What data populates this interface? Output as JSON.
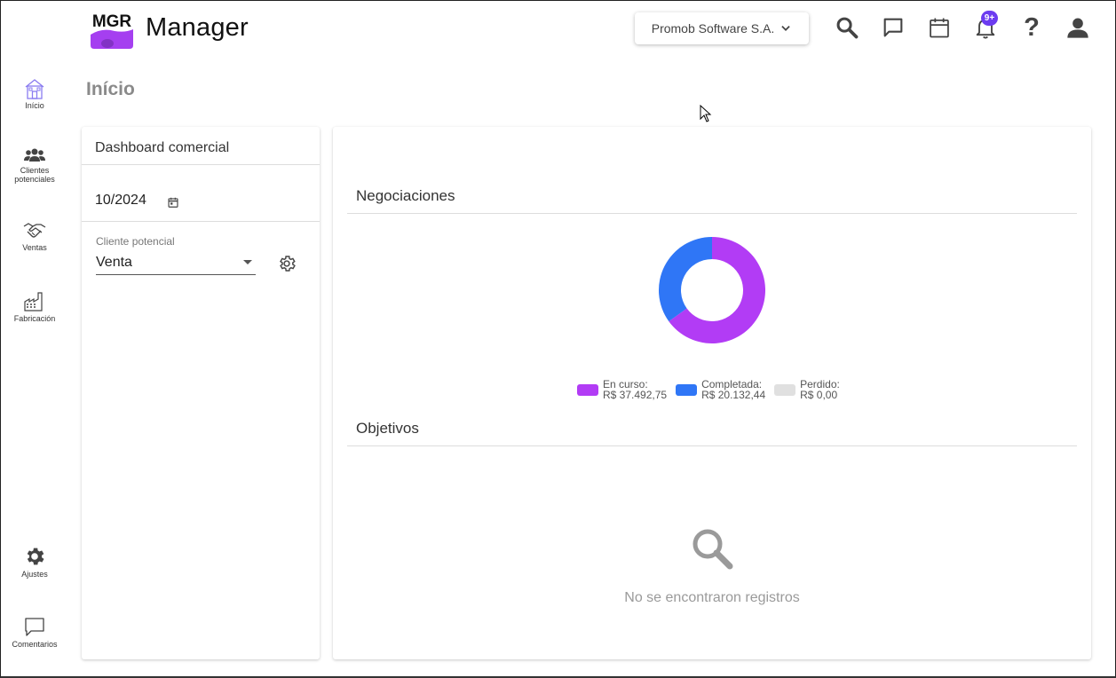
{
  "header": {
    "logo_text": "MGR",
    "app_title": "Manager",
    "company_selector": "Promob Software S.A.",
    "notification_badge": "9+",
    "icons": [
      "search-icon",
      "chat-icon",
      "calendar-icon",
      "bell-icon",
      "help-icon",
      "account-icon"
    ],
    "help_glyph": "?"
  },
  "sidebar": {
    "items": [
      {
        "label": "Início",
        "icon": "home-icon"
      },
      {
        "label": "Clientes potenciales",
        "icon": "people-icon"
      },
      {
        "label": "Ventas",
        "icon": "handshake-icon"
      },
      {
        "label": "Fabricación",
        "icon": "factory-icon"
      },
      {
        "label": "Ajustes",
        "icon": "gear-icon"
      },
      {
        "label": "Comentarios",
        "icon": "comment-icon"
      }
    ]
  },
  "page": {
    "title": "Início"
  },
  "filters": {
    "title": "Dashboard comercial",
    "date_value": "10/2024",
    "select_label": "Cliente potencial",
    "select_value": "Venta"
  },
  "negociaciones": {
    "title": "Negociaciones",
    "legend": [
      {
        "label": "En curso:",
        "value": "R$ 37.492,75",
        "color": "#b23cf5"
      },
      {
        "label": "Completada:",
        "value": "R$ 20.132,44",
        "color": "#2f76f6"
      },
      {
        "label": "Perdido:",
        "value": "R$ 0,00",
        "color": "#e0e0e0"
      }
    ]
  },
  "objetivos": {
    "title": "Objetivos",
    "empty_message": "No se encontraron registros"
  },
  "chart_data": {
    "type": "pie",
    "categories": [
      "En curso",
      "Completada",
      "Perdido"
    ],
    "values": [
      37492.75,
      20132.44,
      0
    ],
    "colors": [
      "#b23cf5",
      "#2f76f6",
      "#e0e0e0"
    ],
    "donut": true,
    "legend": "bottom"
  }
}
